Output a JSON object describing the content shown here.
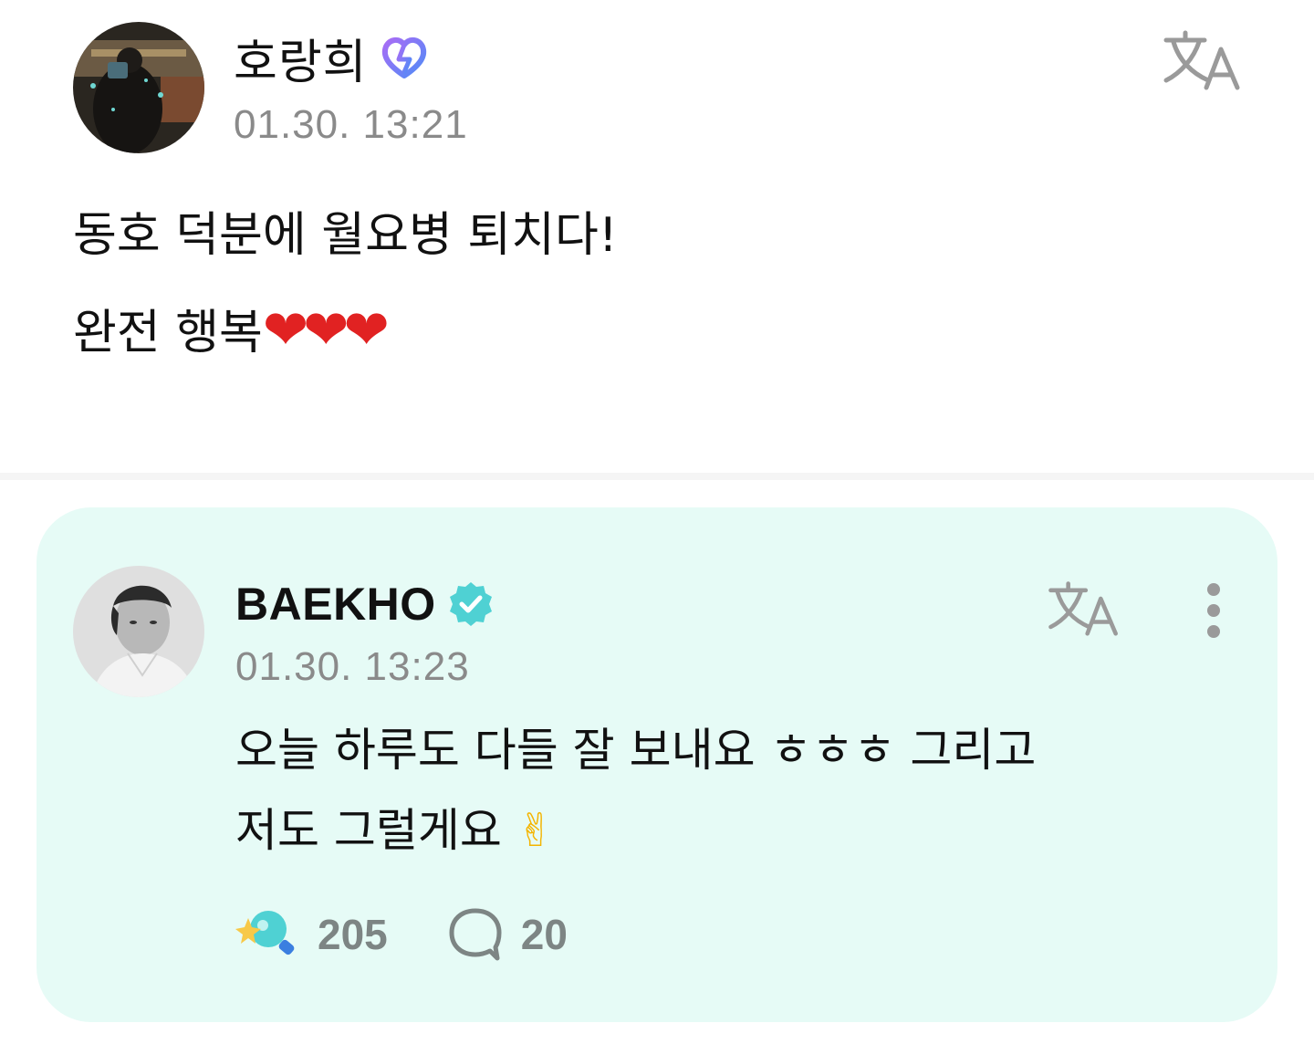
{
  "post": {
    "author": "호랑희",
    "timestamp": "01.30. 13:21",
    "lines": [
      "동호 덕분에 월요병 퇴치다!",
      "완전 행복"
    ],
    "hearts": "❤❤❤",
    "badge_icon": "membership-badge-icon",
    "translate_icon": "translate-icon"
  },
  "reply": {
    "author": "BAEKHO",
    "timestamp": "01.30. 13:23",
    "lines": [
      "오늘 하루도 다들 잘 보내요 ㅎㅎㅎ 그리고",
      "저도 그럴게요"
    ],
    "emoji": "✌",
    "verified_icon": "verified-badge-icon",
    "translate_icon": "translate-icon",
    "more_icon": "more-vertical-icon",
    "likes": "205",
    "comments": "20",
    "card_color": "#e6fbf6",
    "accent_color": "#4fd1d3"
  }
}
